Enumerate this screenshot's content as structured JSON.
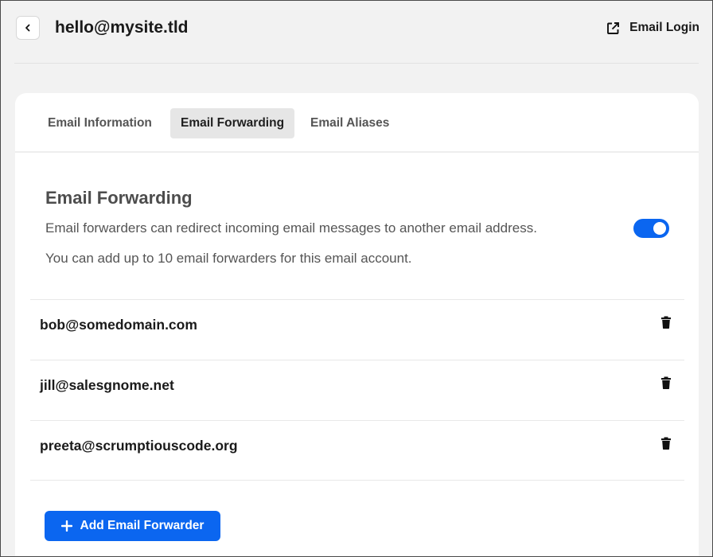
{
  "header": {
    "title": "hello@mysite.tld",
    "back_icon": "chevron-left-icon",
    "login_label": "Email Login",
    "login_icon": "external-link-icon"
  },
  "tabs": [
    {
      "label": "Email Information",
      "active": false
    },
    {
      "label": "Email Forwarding",
      "active": true
    },
    {
      "label": "Email Aliases",
      "active": false
    }
  ],
  "forwarding": {
    "title": "Email Forwarding",
    "description": "Email forwarders can redirect incoming email messages to another email address.",
    "limit_note": "You can add up to 10 email forwarders for this email account.",
    "enabled": true,
    "forwarders": [
      {
        "address": "bob@somedomain.com"
      },
      {
        "address": "jill@salesgnome.net"
      },
      {
        "address": "preeta@scrumptiouscode.org"
      }
    ],
    "add_label": "Add Email Forwarder"
  },
  "colors": {
    "accent": "#0b66f0",
    "background": "#f2f2f2",
    "card": "#ffffff"
  }
}
